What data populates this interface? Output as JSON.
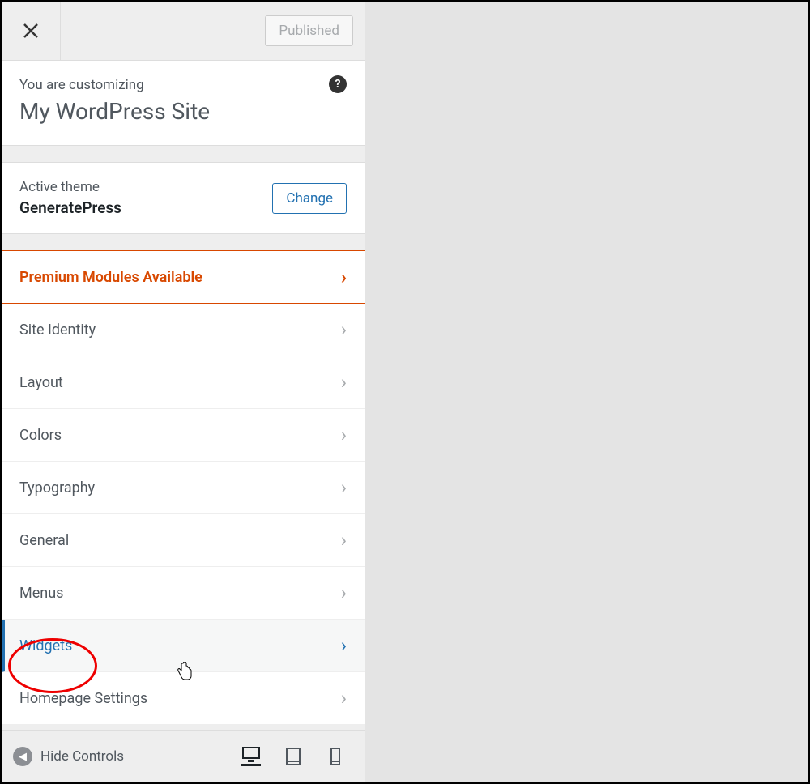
{
  "topbar": {
    "publish_label": "Published"
  },
  "header": {
    "subtitle": "You are customizing",
    "title": "My WordPress Site"
  },
  "theme": {
    "label": "Active theme",
    "name": "GeneratePress",
    "change_label": "Change"
  },
  "sections": [
    {
      "label": "Premium Modules Available",
      "kind": "premium"
    },
    {
      "label": "Site Identity",
      "kind": "normal"
    },
    {
      "label": "Layout",
      "kind": "normal"
    },
    {
      "label": "Colors",
      "kind": "normal"
    },
    {
      "label": "Typography",
      "kind": "normal"
    },
    {
      "label": "General",
      "kind": "normal"
    },
    {
      "label": "Menus",
      "kind": "normal"
    },
    {
      "label": "Widgets",
      "kind": "hover"
    },
    {
      "label": "Homepage Settings",
      "kind": "normal"
    }
  ],
  "footer": {
    "hide_label": "Hide Controls"
  }
}
